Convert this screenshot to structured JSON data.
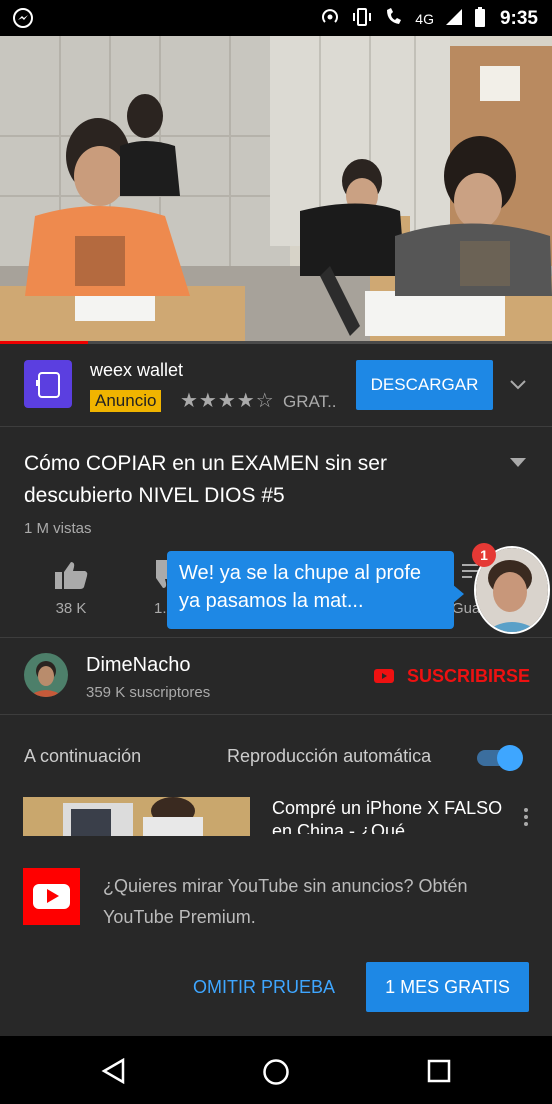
{
  "status_bar": {
    "time": "9:35",
    "network_label": "4G",
    "network_label_2": "4G"
  },
  "player": {
    "progress": 0.16
  },
  "ad": {
    "app_name": "weex wallet",
    "badge": "Anuncio",
    "stars": "★★★★☆",
    "price": "GRAT..",
    "button": "DESCARGAR"
  },
  "video": {
    "title": "Cómo COPIAR en un EXAMEN sin ser descubierto NIVEL DIOS #5",
    "views": "1 M vistas",
    "likes": "38 K",
    "dislikes": "1.",
    "save_label": "Gua"
  },
  "chat": {
    "message": "We! ya se la chupe al profe ya pasamos la mat...",
    "badge_count": "1"
  },
  "channel": {
    "name": "DimeNacho",
    "subscribers": "359 K suscriptores",
    "subscribe": "SUSCRIBIRSE"
  },
  "up_next": {
    "label": "A continuación",
    "autoplay_label": "Reproducción automática",
    "autoplay_on": true,
    "next_title": "Compré un iPhone X FALSO en China - ¿Qué"
  },
  "promo": {
    "text": "¿Quieres mirar YouTube sin anuncios? Obtén YouTube Premium.",
    "skip": "OMITIR PRUEBA",
    "trial": "1 MES GRATIS"
  },
  "colors": {
    "accent": "#1e88e5",
    "youtube_red": "#ff0000",
    "ad_badge": "#f0b400"
  }
}
